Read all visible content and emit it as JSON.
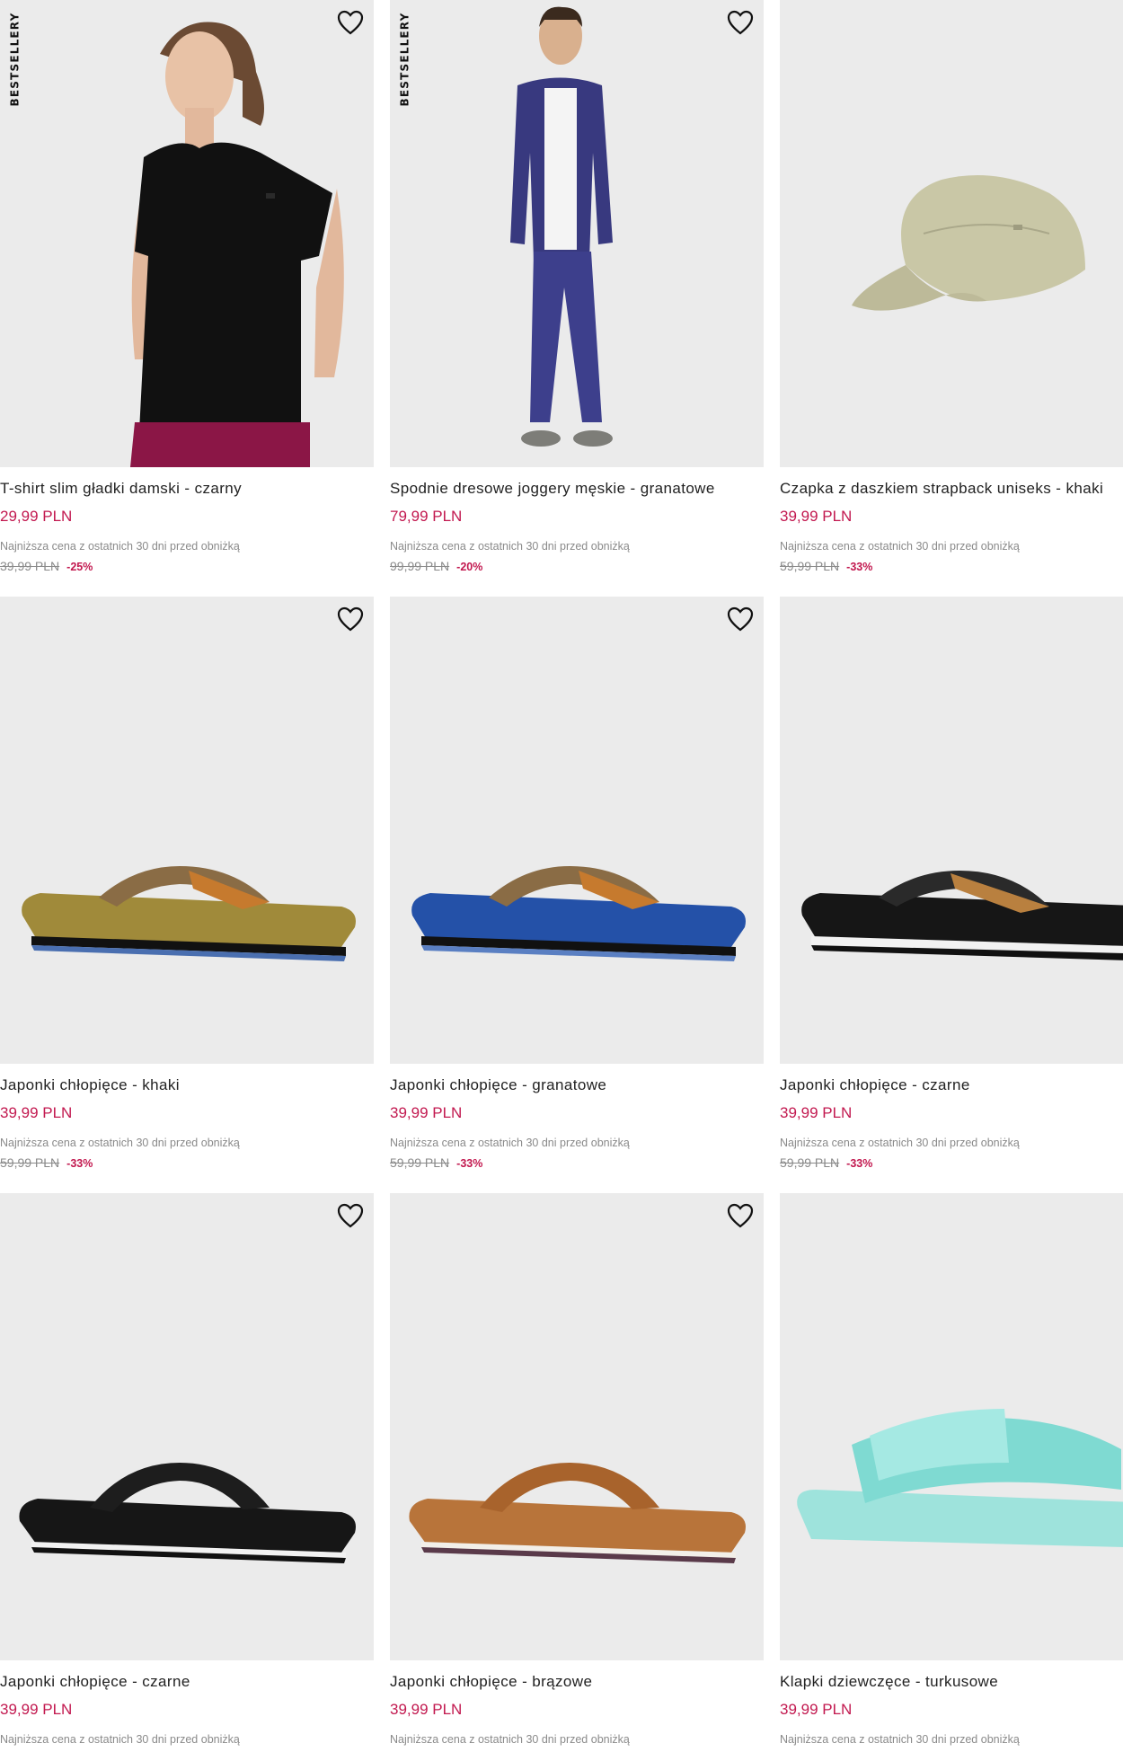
{
  "colors": {
    "price": "#c2184f",
    "image_bg": "#ebebeb",
    "muted": "#8a8a8a"
  },
  "icons": {
    "favorite": "heart-outline-icon"
  },
  "products": [
    {
      "badge": "BESTSELLERY",
      "name": "T-shirt slim gładki damski - czarny",
      "price": "29,99 PLN",
      "lowest_note": "Najniższa cena z ostatnich 30 dni przed obniżką",
      "old_price": "39,99 PLN",
      "discount": "-25%",
      "image": "black-tshirt-woman"
    },
    {
      "badge": "BESTSELLERY",
      "name": "Spodnie dresowe joggery męskie - granatowe",
      "price": "79,99 PLN",
      "lowest_note": "Najniższa cena z ostatnich 30 dni przed obniżką",
      "old_price": "99,99 PLN",
      "discount": "-20%",
      "image": "navy-tracksuit-man"
    },
    {
      "badge": "",
      "name": "Czapka z daszkiem strapback uniseks - khaki",
      "price": "39,99 PLN",
      "lowest_note": "Najniższa cena z ostatnich 30 dni przed obniżką",
      "old_price": "59,99 PLN",
      "discount": "-33%",
      "image": "khaki-cap"
    },
    {
      "badge": "",
      "name": "Japonki chłopięce - khaki",
      "price": "39,99 PLN",
      "lowest_note": "Najniższa cena z ostatnich 30 dni przed obniżką",
      "old_price": "59,99 PLN",
      "discount": "-33%",
      "image": "khaki-flipflop"
    },
    {
      "badge": "",
      "name": "Japonki chłopięce - granatowe",
      "price": "39,99 PLN",
      "lowest_note": "Najniższa cena z ostatnich 30 dni przed obniżką",
      "old_price": "59,99 PLN",
      "discount": "-33%",
      "image": "blue-flipflop"
    },
    {
      "badge": "",
      "name": "Japonki chłopięce - czarne",
      "price": "39,99 PLN",
      "lowest_note": "Najniższa cena z ostatnich 30 dni przed obniżką",
      "old_price": "59,99 PLN",
      "discount": "-33%",
      "image": "black-flipflop-patch"
    },
    {
      "badge": "",
      "name": "Japonki chłopięce - czarne",
      "price": "39,99 PLN",
      "lowest_note": "Najniższa cena z ostatnich 30 dni przed obniżką",
      "old_price": "",
      "discount": "",
      "image": "black-flipflop"
    },
    {
      "badge": "",
      "name": "Japonki chłopięce - brązowe",
      "price": "39,99 PLN",
      "lowest_note": "Najniższa cena z ostatnich 30 dni przed obniżką",
      "old_price": "",
      "discount": "",
      "image": "brown-flipflop"
    },
    {
      "badge": "",
      "name": "Klapki dziewczęce - turkusowe",
      "price": "39,99 PLN",
      "lowest_note": "Najniższa cena z ostatnich 30 dni przed obniżką",
      "old_price": "",
      "discount": "",
      "image": "turquoise-slide"
    }
  ]
}
